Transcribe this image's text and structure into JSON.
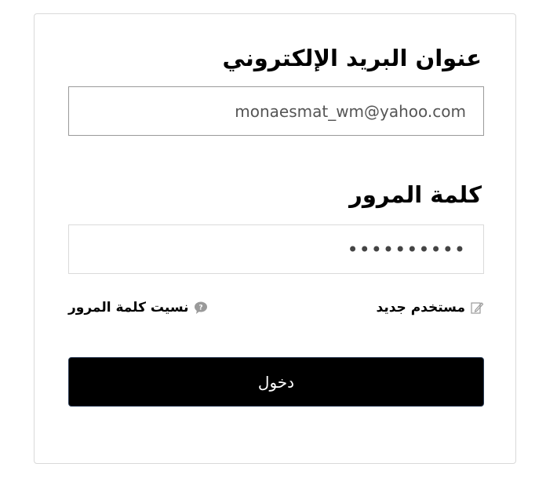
{
  "form": {
    "email_label": "عنوان البريد الإلكتروني",
    "email_value": "monaesmat_wm@yahoo.com",
    "password_label": "كلمة المرور",
    "password_mask": "••••••••••",
    "new_user_link": "مستخدم جديد",
    "new_user_icon": "edit-icon",
    "forgot_password_link": "نسيت كلمة المرور",
    "forgot_password_icon": "question-bubble-icon",
    "login_button": "دخول"
  },
  "colors": {
    "button_background": "#000000",
    "button_text": "#ffffff",
    "card_border": "#d9d9d9",
    "input_text": "#555555"
  }
}
